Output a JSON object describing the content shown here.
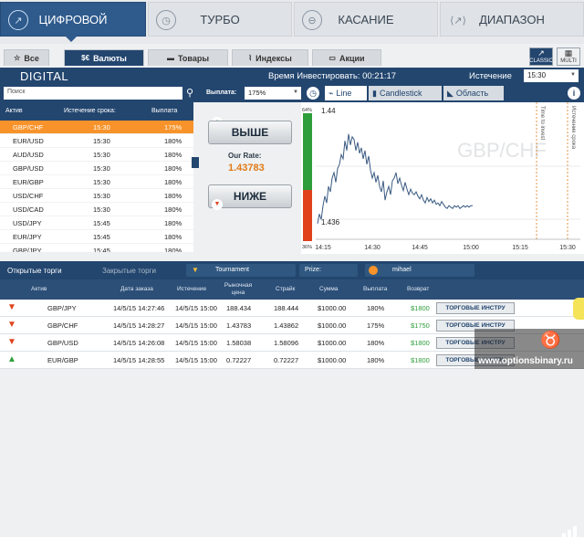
{
  "top_tabs": [
    {
      "label": "ЦИФРОВОЙ",
      "icon": "chart-up-icon",
      "active": true
    },
    {
      "label": "ТУРБО",
      "icon": "clock-icon",
      "active": false
    },
    {
      "label": "КАСАНИЕ",
      "icon": "touch-icon",
      "active": false
    },
    {
      "label": "ДИАПАЗОН",
      "icon": "range-icon",
      "active": false
    }
  ],
  "sub_tabs": [
    {
      "label": "Все",
      "icon": "star-icon"
    },
    {
      "label": "Валюты",
      "icon": "currency-icon"
    },
    {
      "label": "Товары",
      "icon": "commodity-icon"
    },
    {
      "label": "Индексы",
      "icon": "index-icon"
    },
    {
      "label": "Акции",
      "icon": "stocks-icon"
    }
  ],
  "view_buttons": {
    "classic": "CLASSIC",
    "multi": "MULTI"
  },
  "info_bar": {
    "mode": "DIGITAL",
    "invest_time": "Время Инвестировать: 00:21:17",
    "expiry_label": "Истечение",
    "expiry_value": "15:30"
  },
  "search": {
    "placeholder": "Поиск",
    "payout_label": "Выплата:",
    "payout_value": "175%"
  },
  "chart_tabs": [
    "Line",
    "Candlestick",
    "Область"
  ],
  "asset_table": {
    "headers": [
      "Актив",
      "Истечение срока:",
      "Выплата"
    ],
    "rows": [
      {
        "asset": "GBP/CHF",
        "expiry": "15:30",
        "payout": "175%",
        "selected": true
      },
      {
        "asset": "EUR/USD",
        "expiry": "15:30",
        "payout": "180%"
      },
      {
        "asset": "AUD/USD",
        "expiry": "15:30",
        "payout": "180%"
      },
      {
        "asset": "GBP/USD",
        "expiry": "15:30",
        "payout": "180%"
      },
      {
        "asset": "EUR/GBP",
        "expiry": "15:30",
        "payout": "180%"
      },
      {
        "asset": "USD/CHF",
        "expiry": "15:30",
        "payout": "180%"
      },
      {
        "asset": "USD/CAD",
        "expiry": "15:30",
        "payout": "180%"
      },
      {
        "asset": "USD/JPY",
        "expiry": "15:45",
        "payout": "180%"
      },
      {
        "asset": "EUR/JPY",
        "expiry": "15:45",
        "payout": "180%"
      },
      {
        "asset": "GBP/JPY",
        "expiry": "15:45",
        "payout": "180%"
      }
    ]
  },
  "trade": {
    "higher": "ВЫШЕ",
    "lower": "НИЖЕ",
    "rate_label": "Our Rate:",
    "rate_value": "1.43783"
  },
  "chart": {
    "watermark": "GBP/CHF",
    "top_pct": "64%",
    "bottom_pct": "36%",
    "y_top": "1.44",
    "y_bottom": "1.436",
    "x_ticks": [
      "14:15",
      "14:30",
      "14:45",
      "15:00",
      "15:15",
      "15:30"
    ],
    "time_to_invest": "Time to invest",
    "expiry_vertical": "Истечение срока"
  },
  "chart_data": {
    "type": "line",
    "x": [
      0,
      2,
      4,
      6,
      8,
      10,
      12,
      14,
      16,
      18,
      20,
      22,
      24,
      26,
      28,
      30,
      32,
      34,
      36,
      38,
      40,
      42,
      44,
      46,
      48,
      50,
      52,
      54,
      56,
      58,
      60,
      62,
      64,
      66,
      68,
      70,
      72,
      74,
      76,
      78,
      80,
      82,
      84,
      86,
      88,
      90,
      92,
      94,
      96,
      98,
      100,
      102,
      104,
      106,
      108,
      110,
      112,
      114,
      116,
      118,
      120,
      122,
      124,
      126,
      128,
      130,
      132,
      134,
      136,
      138,
      140,
      142,
      144,
      146,
      148,
      150,
      152,
      154,
      156,
      158,
      160,
      162,
      164,
      166,
      168,
      170
    ],
    "y": [
      1.4365,
      1.4372,
      1.4368,
      1.4378,
      1.4385,
      1.438,
      1.4392,
      1.4388,
      1.4398,
      1.4402,
      1.4395,
      1.4405,
      1.4408,
      1.4415,
      1.4412,
      1.4425,
      1.4418,
      1.443,
      1.4422,
      1.4428,
      1.4426,
      1.4418,
      1.4424,
      1.4416,
      1.442,
      1.4412,
      1.4418,
      1.4408,
      1.4414,
      1.4404,
      1.4398,
      1.4402,
      1.4395,
      1.44,
      1.4392,
      1.4388,
      1.4396,
      1.4382,
      1.4388,
      1.4392,
      1.4386,
      1.4396,
      1.4398,
      1.4402,
      1.4394,
      1.4398,
      1.4393,
      1.4389,
      1.4395,
      1.439,
      1.4386,
      1.439,
      1.4387,
      1.4386,
      1.4388,
      1.4385,
      1.4383,
      1.4386,
      1.4382,
      1.438,
      1.4384,
      1.4381,
      1.4383,
      1.438,
      1.4382,
      1.4379,
      1.438,
      1.4378,
      1.4381,
      1.4379,
      1.4377,
      1.4376,
      1.4378,
      1.4377,
      1.4376,
      1.4378,
      1.4377,
      1.4378,
      1.4376,
      1.4377,
      1.4378,
      1.4377,
      1.4378,
      1.4377,
      1.4378,
      1.4378
    ],
    "ylim": [
      1.4355,
      1.4445
    ]
  },
  "bottom": {
    "open_trades": "Открытые торги",
    "closed_trades": "Закрытые торги",
    "tournament": "Tournament",
    "prize": "Prize:",
    "user": "mihael",
    "columns": [
      "Актив",
      "Дата заказа",
      "Истечение",
      "Рыночная цена",
      "Страйк",
      "Сумма",
      "Выплата",
      "Возврат"
    ],
    "rows": [
      {
        "dir": "down",
        "asset": "GBP/JPY",
        "date": "14/5/15 14:27:46",
        "expiry": "14/5/15 15:00",
        "market": "188.434",
        "strike": "188.444",
        "amount": "$1000.00",
        "payout": "180%",
        "ret": "$1800",
        "tools": "ТОРГОВЫЕ ИНСТРУ"
      },
      {
        "dir": "down",
        "asset": "GBP/CHF",
        "date": "14/5/15 14:28:27",
        "expiry": "14/5/15 15:00",
        "market": "1.43783",
        "strike": "1.43862",
        "amount": "$1000.00",
        "payout": "175%",
        "ret": "$1750",
        "tools": "ТОРГОВЫЕ ИНСТРУ"
      },
      {
        "dir": "down",
        "asset": "GBP/USD",
        "date": "14/5/15 14:26:08",
        "expiry": "14/5/15 15:00",
        "market": "1.58038",
        "strike": "1.58096",
        "amount": "$1000.00",
        "payout": "180%",
        "ret": "$1800",
        "tools": "ТОРГОВЫЕ ИНСТРУ"
      },
      {
        "dir": "up",
        "asset": "EUR/GBP",
        "date": "14/5/15 14:28:55",
        "expiry": "14/5/15 15:00",
        "market": "0.72227",
        "strike": "0.72227",
        "amount": "$1000.00",
        "payout": "180%",
        "ret": "$1800",
        "tools": "ТОРГОВЫЕ ИНСТРУ"
      }
    ]
  },
  "watermark_url": "www.optionsbinary.ru",
  "colors": {
    "primary": "#23466f",
    "accent": "#f7932a",
    "up": "#2e9e3a",
    "down": "#e0421c"
  }
}
